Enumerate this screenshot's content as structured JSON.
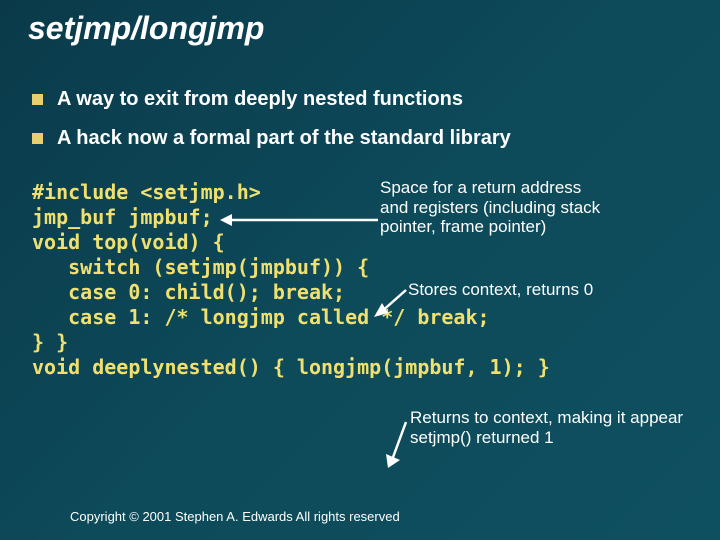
{
  "title": "setjmp/longjmp",
  "bullets": [
    "A way to exit from deeply nested functions",
    "A hack now a formal part of the standard library"
  ],
  "code": {
    "l1": "#include <setjmp.h>",
    "l2": "jmp_buf jmpbuf;",
    "l3": "",
    "l4": "void top(void) {",
    "l5": "   switch (setjmp(jmpbuf)) {",
    "l6": "   case 0: child(); break;",
    "l7": "   case 1: /* longjmp called */ break;",
    "l8": "} }",
    "l9": "",
    "l10": "void deeplynested() { longjmp(jmpbuf, 1); }"
  },
  "annotations": {
    "a1": "Space for a return address and registers (including stack pointer, frame pointer)",
    "a2": "Stores context, returns 0",
    "a3": "Returns to context, making it appear setjmp() returned 1"
  },
  "copyright": "Copyright © 2001 Stephen A. Edwards  All rights reserved"
}
